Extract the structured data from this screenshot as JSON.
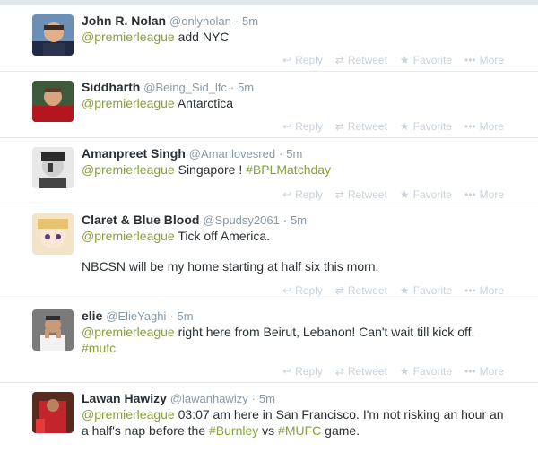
{
  "actions": {
    "reply": "Reply",
    "retweet": "Retweet",
    "favorite": "Favorite",
    "more": "More"
  },
  "tweets": [
    {
      "name": "John R. Nolan",
      "handle": "@onlynolan",
      "time": "5m",
      "lines": [
        [
          {
            "t": "@premierleague",
            "k": "mention"
          },
          {
            "t": " add NYC",
            "k": "text"
          }
        ]
      ]
    },
    {
      "name": "Siddharth",
      "handle": "@Being_Sid_lfc",
      "time": "5m",
      "lines": [
        [
          {
            "t": "@premierleague",
            "k": "mention"
          },
          {
            "t": " Antarctica",
            "k": "text"
          }
        ]
      ]
    },
    {
      "name": "Amanpreet Singh",
      "handle": "@Amanlovesred",
      "time": "5m",
      "lines": [
        [
          {
            "t": "@premierleague",
            "k": "mention"
          },
          {
            "t": " Singapore ! ",
            "k": "text"
          },
          {
            "t": "#BPLMatchday",
            "k": "hashtag"
          }
        ]
      ]
    },
    {
      "name": "Claret & Blue Blood",
      "handle": "@Spudsy2061",
      "time": "5m",
      "lines": [
        [
          {
            "t": "@premierleague",
            "k": "mention"
          },
          {
            "t": " Tick off America.",
            "k": "text"
          }
        ],
        [
          {
            "t": "NBCSN will be my home starting at half six this morn.",
            "k": "text"
          }
        ]
      ]
    },
    {
      "name": "elie",
      "handle": "@ElieYaghi",
      "time": "5m",
      "lines": [
        [
          {
            "t": "@premierleague",
            "k": "mention"
          },
          {
            "t": " right here from Beirut, Lebanon! Can't wait till kick off. ",
            "k": "text"
          },
          {
            "t": "#mufc",
            "k": "hashtag"
          }
        ]
      ]
    },
    {
      "name": "Lawan Hawizy",
      "handle": "@lawanhawizy",
      "time": "5m",
      "lines": [
        [
          {
            "t": "@premierleague",
            "k": "mention"
          },
          {
            "t": " 03:07 am here in San Francisco. I'm not risking an hour an a half's nap before the ",
            "k": "text"
          },
          {
            "t": "#Burnley",
            "k": "hashtag"
          },
          {
            "t": " vs ",
            "k": "text"
          },
          {
            "t": "#MUFC",
            "k": "hashtag"
          },
          {
            "t": " game.",
            "k": "text"
          }
        ]
      ]
    }
  ]
}
